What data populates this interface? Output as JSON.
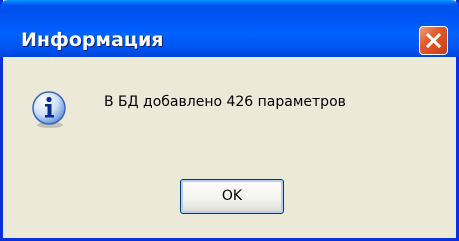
{
  "window": {
    "title": "Информация",
    "title_color": "#ffffff",
    "titlebar_color": "#0058ee",
    "frame_color": "#ece9d8"
  },
  "titlebar": {
    "close_icon": "close-icon",
    "close_color": "#e35a2c"
  },
  "content": {
    "icon": "info-icon",
    "message": "В БД добавлено 426 параметров"
  },
  "buttons": {
    "ok_label": "OK"
  }
}
